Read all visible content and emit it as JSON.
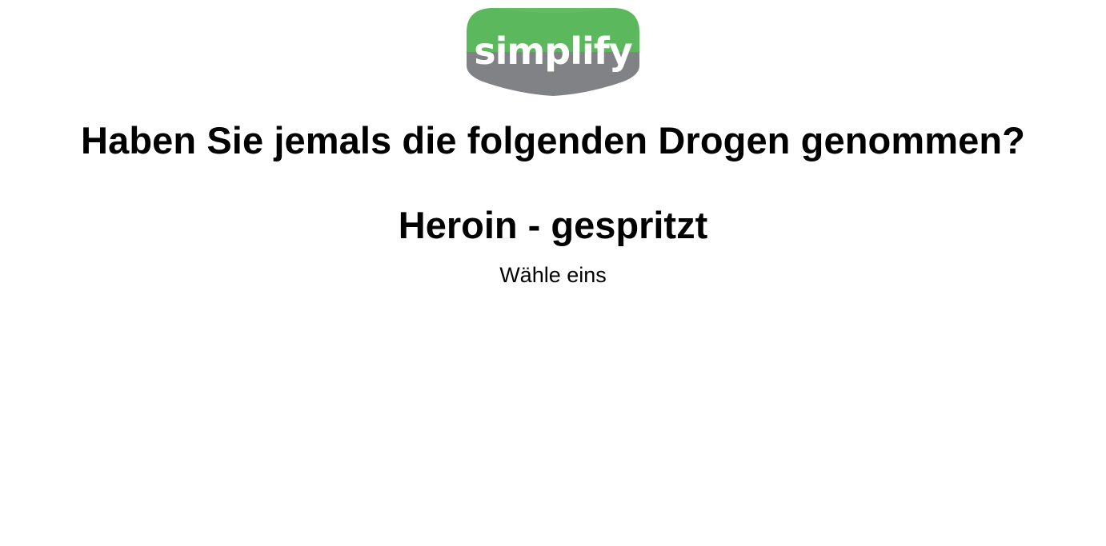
{
  "brand": {
    "logo_text": "simplify",
    "colors": {
      "logo_top": "#5cb85c",
      "logo_bottom": "#808285",
      "logo_text": "#ffffff"
    }
  },
  "survey": {
    "question": "Haben Sie jemals die folgenden Drogen genommen?",
    "item": "Heroin - gespritzt",
    "instruction": "Wähle eins"
  }
}
